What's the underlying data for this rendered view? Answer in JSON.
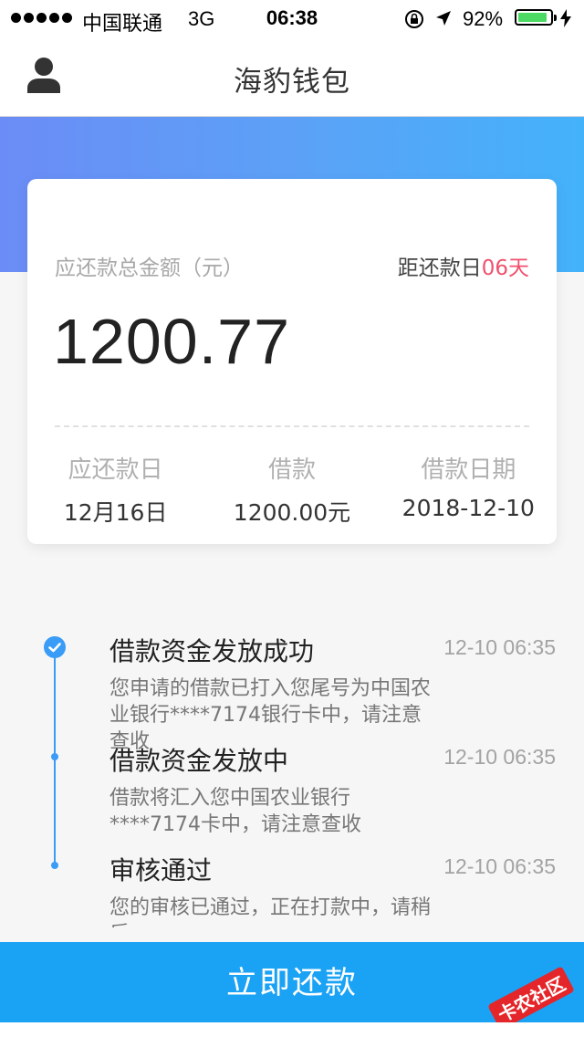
{
  "status_bar": {
    "carrier": "中国联通",
    "network": "3G",
    "time": "06:38",
    "battery_percent": "92%",
    "battery_level": 0.92
  },
  "nav": {
    "title": "海豹钱包",
    "user_icon": "user-icon"
  },
  "card": {
    "total_label": "应还款总金额（元）",
    "countdown_prefix": "距还款日",
    "countdown_days": "06天",
    "amount": "1200.77",
    "columns": [
      {
        "label": "应还款日",
        "value": "12月16日"
      },
      {
        "label": "借款",
        "value": "1200.00元"
      },
      {
        "label": "借款日期",
        "value": "2018-12-10"
      }
    ]
  },
  "timeline": [
    {
      "title": "借款资金发放成功",
      "time": "12-10 06:35",
      "desc": "您申请的借款已打入您尾号为中国农业银行****7174银行卡中，请注意查收"
    },
    {
      "title": "借款资金发放中",
      "time": "12-10 06:35",
      "desc": "借款将汇入您中国农业银行****7174卡中，请注意查收"
    },
    {
      "title": "审核通过",
      "time": "12-10 06:35",
      "desc": "您的审核已通过，正在打款中，请稍后"
    }
  ],
  "repay_button": "立即还款",
  "watermark": "卡农社区",
  "colors": {
    "accent": "#1aa2f5",
    "timeline": "#3a9cf6",
    "highlight": "#f0506e",
    "battery": "#4cd964"
  }
}
